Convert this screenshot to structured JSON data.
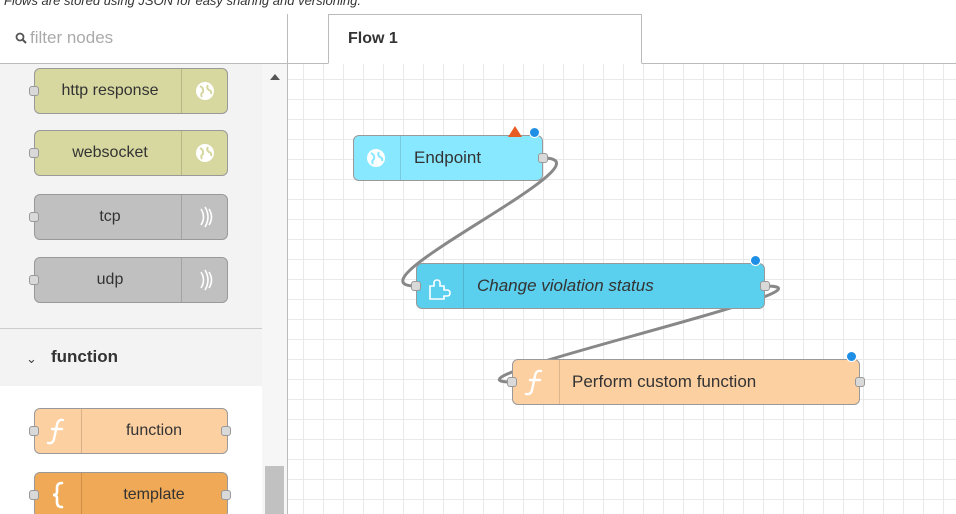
{
  "caption": "Flows are stored using JSON for easy sharing and versioning.",
  "search": {
    "placeholder": "filter nodes"
  },
  "palette": {
    "nodes": [
      {
        "label": "http response",
        "icon": "globe-icon",
        "color": "#d7d7a0"
      },
      {
        "label": "websocket",
        "icon": "globe-icon",
        "color": "#d7d7a0"
      },
      {
        "label": "tcp",
        "icon": "bridge-icon",
        "color": "#c0c0c0"
      },
      {
        "label": "udp",
        "icon": "bridge-icon",
        "color": "#c0c0c0"
      }
    ],
    "category": {
      "chevron": "⌄",
      "title": "function"
    },
    "function_nodes": [
      {
        "label": "function",
        "icon": "function-icon",
        "color": "#fdd0a2"
      },
      {
        "label": "template",
        "icon": "template-icon",
        "color": "#f0aa57"
      }
    ]
  },
  "tabs": [
    {
      "label": "Flow 1"
    }
  ],
  "flow": {
    "nodes": [
      {
        "id": "endpoint",
        "label": "Endpoint",
        "color": "#87e8ff",
        "icon": "globe-icon",
        "italic": false,
        "warning": true,
        "changed": true
      },
      {
        "id": "change",
        "label": "Change violation status",
        "color": "#5bcfee",
        "icon": "subflow-icon",
        "italic": true,
        "warning": false,
        "changed": true
      },
      {
        "id": "custom",
        "label": "Perform custom function",
        "color": "#fdd0a2",
        "icon": "function-icon",
        "italic": false,
        "warning": false,
        "changed": true
      }
    ]
  },
  "colors": {
    "changed_dot": "#1f8fe6",
    "warning": "#e65c23",
    "wire": "#888888"
  }
}
